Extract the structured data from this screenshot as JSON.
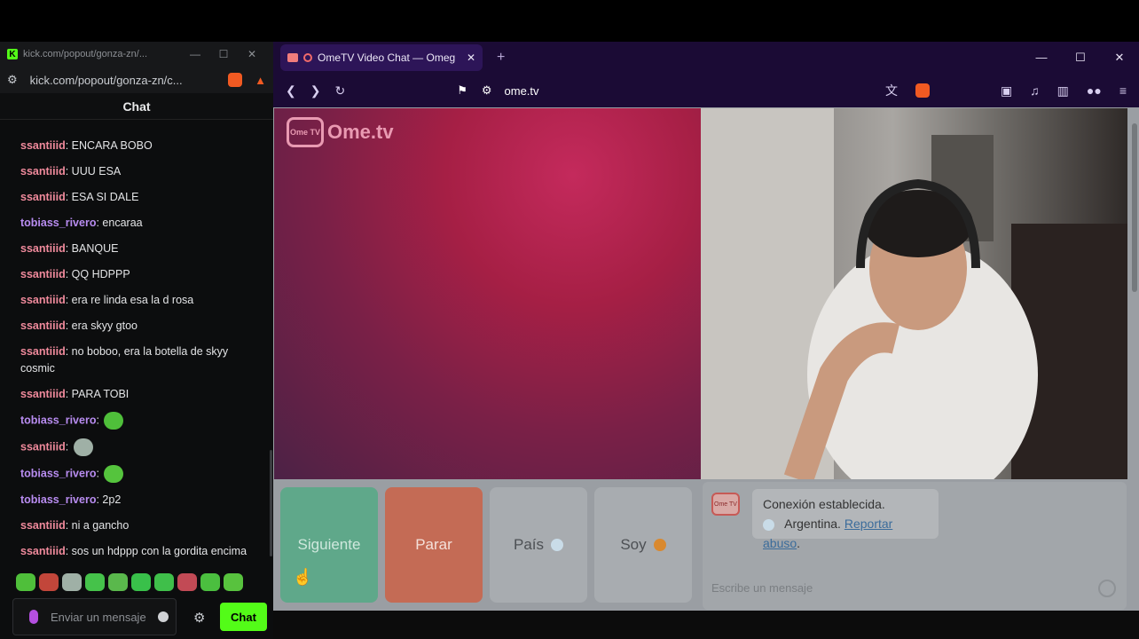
{
  "kick_window": {
    "title": "kick.com/popout/gonza-zn/...",
    "url": "kick.com/popout/gonza-zn/c...",
    "chat_header": "Chat",
    "messages": [
      {
        "user": "ssantiiid",
        "text": "ENCARA BOBO",
        "color": "#f08a9c"
      },
      {
        "user": "ssantiiid",
        "text": "UUU ESA",
        "color": "#f08a9c"
      },
      {
        "user": "ssantiiid",
        "text": "ESA SI DALE",
        "color": "#f08a9c"
      },
      {
        "user": "tobiass_rivero",
        "text": "encaraa",
        "color": "#b88cf0"
      },
      {
        "user": "ssantiiid",
        "text": "BANQUE",
        "color": "#f08a9c"
      },
      {
        "user": "ssantiiid",
        "text": "QQ HDPPP",
        "color": "#f08a9c"
      },
      {
        "user": "ssantiiid",
        "text": "era re linda esa la d rosa",
        "color": "#f08a9c"
      },
      {
        "user": "ssantiiid",
        "text": "era skyy gtoo",
        "color": "#f08a9c"
      },
      {
        "user": "ssantiiid",
        "text": "no boboo, era la botella de skyy cosmic",
        "color": "#f08a9c"
      },
      {
        "user": "ssantiiid",
        "text": "PARA TOBI",
        "color": "#f08a9c"
      },
      {
        "user": "tobiass_rivero",
        "text": "",
        "color": "#b88cf0",
        "emote": "#4fbf3a"
      },
      {
        "user": "ssantiiid",
        "text": "",
        "color": "#f08a9c",
        "emote": "#9fb0a6"
      },
      {
        "user": "tobiass_rivero",
        "text": "",
        "color": "#b88cf0",
        "emote": "#55c43d"
      },
      {
        "user": "tobiass_rivero",
        "text": "2p2",
        "color": "#b88cf0"
      },
      {
        "user": "ssantiiid",
        "text": "ni a gancho",
        "color": "#f08a9c"
      },
      {
        "user": "ssantiiid",
        "text": "sos un hdppp con la gordita encima",
        "color": "#f08a9c"
      }
    ],
    "emote_colors": [
      "#4fbf3a",
      "#c2463a",
      "#9fb0a6",
      "#45c24a",
      "#5ab84c",
      "#39c04a",
      "#3fbf4a",
      "#c24a55",
      "#4bbf3f",
      "#58c23e"
    ],
    "input_placeholder": "Enviar un mensaje",
    "send_label": "Chat"
  },
  "browser": {
    "tab_title": "OmeTV Video Chat — Omeg",
    "address": "ome.tv",
    "site_logo": "Ome.tv",
    "logo_badge": "Ome TV",
    "buttons": {
      "next": "Siguiente",
      "stop": "Parar",
      "country": "País",
      "gender": "Soy"
    },
    "chat": {
      "status": "Conexión establecida.",
      "country": "Argentina.",
      "report": "Reportar abuso",
      "report_suffix": ".",
      "placeholder": "Escribe un mensaje"
    }
  }
}
